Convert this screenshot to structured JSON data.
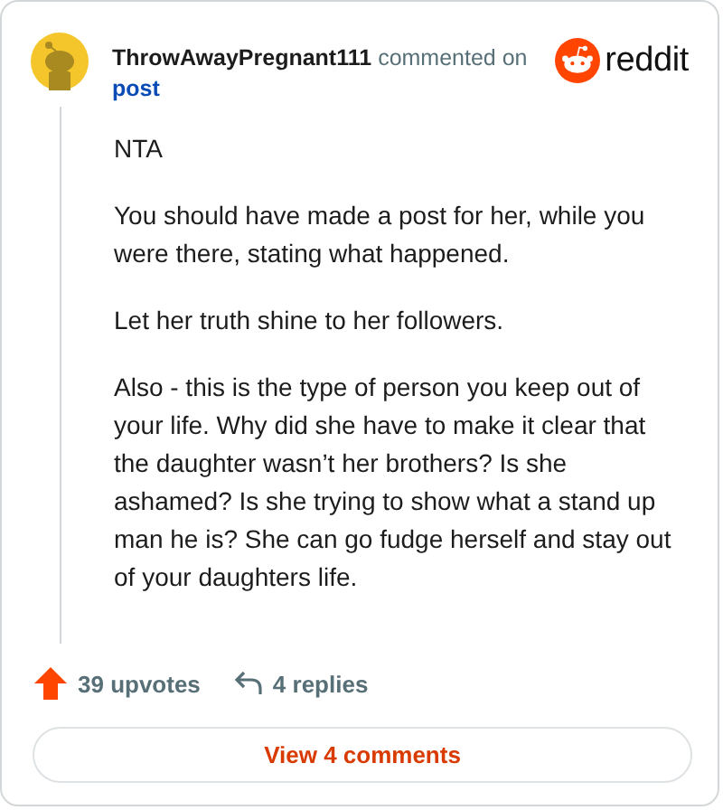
{
  "comment": {
    "author": "ThrowAwayPregnant111",
    "action": "commented on",
    "link": "post",
    "brand": "reddit",
    "paragraphs": [
      "NTA",
      "You should have made a post for her, while you were there, stating what happened.",
      "Let her truth shine to her followers.",
      "Also - this is the type of person you keep out of your life. Why did she have to make it clear that the daughter wasn’t her brothers? Is she ashamed? Is she trying to show what a stand up man he is? She can go fudge herself and stay out of your daughters life."
    ]
  },
  "footer": {
    "upvotes": "39 upvotes",
    "replies": "4 replies",
    "button": "View 4 comments"
  }
}
